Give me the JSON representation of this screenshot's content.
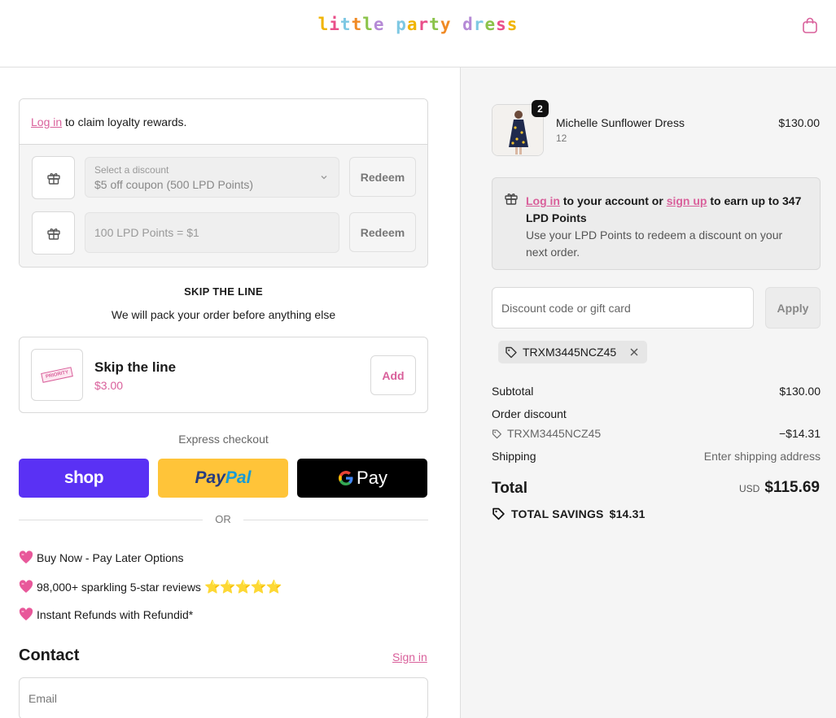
{
  "header": {
    "logo_letters": [
      {
        "ch": "l",
        "color": "#f0b400"
      },
      {
        "ch": "i",
        "color": "#e94f8a"
      },
      {
        "ch": "t",
        "color": "#7ec8e3"
      },
      {
        "ch": "t",
        "color": "#f08a24"
      },
      {
        "ch": "l",
        "color": "#8bc34a"
      },
      {
        "ch": "e",
        "color": "#b58ad6"
      },
      {
        "ch": " ",
        "color": "#000000"
      },
      {
        "ch": "p",
        "color": "#7ec8e3"
      },
      {
        "ch": "a",
        "color": "#f0b400"
      },
      {
        "ch": "r",
        "color": "#e94f8a"
      },
      {
        "ch": "t",
        "color": "#8bc34a"
      },
      {
        "ch": "y",
        "color": "#f08a24"
      },
      {
        "ch": " ",
        "color": "#000000"
      },
      {
        "ch": "d",
        "color": "#b58ad6"
      },
      {
        "ch": "r",
        "color": "#7ec8e3"
      },
      {
        "ch": "e",
        "color": "#8bc34a"
      },
      {
        "ch": "s",
        "color": "#e94f8a"
      },
      {
        "ch": "s",
        "color": "#f0b400"
      }
    ],
    "cart_icon": "shopping-bag-icon"
  },
  "loyalty": {
    "login_link": "Log in",
    "login_text": " to claim loyalty rewards.",
    "select_label": "Select a discount",
    "select_value": "$5 off coupon (500 LPD Points)",
    "points_placeholder": "100 LPD Points = $1",
    "redeem_label": "Redeem"
  },
  "skip": {
    "title": "SKIP THE LINE",
    "subtitle": "We will pack your order before anything else",
    "product_name": "Skip the line",
    "price": "$3.00",
    "add_label": "Add",
    "thumb_text": "PRIORITY"
  },
  "express": {
    "label": "Express checkout",
    "shop_label": "shop",
    "paypal_pay": "Pay",
    "paypal_pal": "Pal",
    "gpay_label": "Pay",
    "or_label": "OR"
  },
  "perks": [
    "Buy Now - Pay Later Options",
    "98,000+ sparkling 5-star reviews",
    "Instant Refunds with Refundid*"
  ],
  "perk_stars": "⭐⭐⭐⭐⭐",
  "contact": {
    "title": "Contact",
    "signin_label": "Sign in",
    "email_placeholder": "Email"
  },
  "order": {
    "product_name": "Michelle Sunflower Dress",
    "variant": "12",
    "quantity": "2",
    "price": "$130.00",
    "note_login": "Log in",
    "note_mid": " to your account or ",
    "note_signup": "sign up",
    "note_end": " to earn up to 347 LPD Points",
    "note_sub": "Use your LPD Points to redeem a discount on your next order.",
    "discount_placeholder": "Discount code or gift card",
    "apply_label": "Apply",
    "applied_code": "TRXM3445NCZ45",
    "subtotal_label": "Subtotal",
    "subtotal_value": "$130.00",
    "order_discount_label": "Order discount",
    "discount_code": "TRXM3445NCZ45",
    "discount_value": "−$14.31",
    "shipping_label": "Shipping",
    "shipping_value": "Enter shipping address",
    "total_label": "Total",
    "currency": "USD",
    "total_value": "$115.69",
    "savings_label": "TOTAL SAVINGS",
    "savings_value": "$14.31"
  },
  "colors": {
    "brand_pink": "#d9609b",
    "shop_purple": "#5a31f4",
    "paypal_yellow": "#ffc439"
  }
}
